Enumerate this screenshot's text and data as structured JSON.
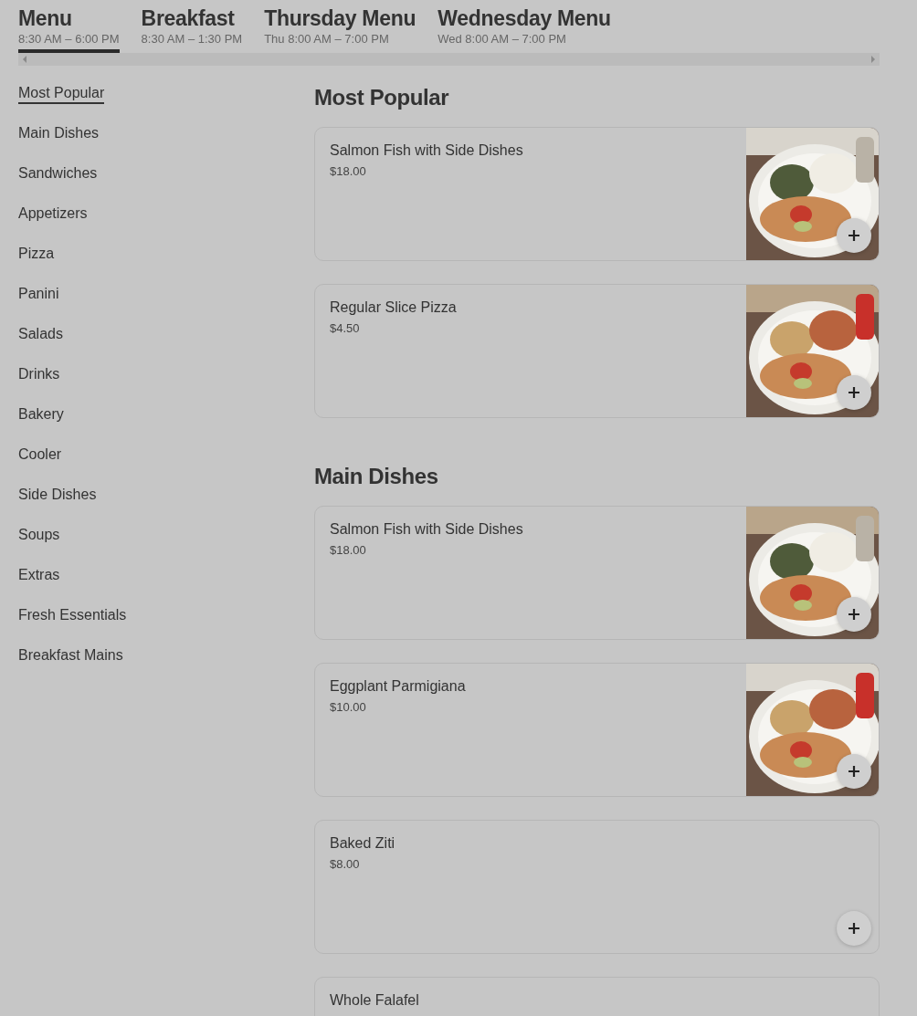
{
  "menu_tabs": [
    {
      "title": "Menu",
      "hours": "8:30 AM – 6:00 PM",
      "selected": true
    },
    {
      "title": "Breakfast",
      "hours": "8:30 AM – 1:30 PM",
      "selected": false
    },
    {
      "title": "Thursday Menu",
      "hours": "Thu 8:00 AM – 7:00 PM",
      "selected": false
    },
    {
      "title": "Wednesday Menu",
      "hours": "Wed 8:00 AM – 7:00 PM",
      "selected": false
    }
  ],
  "sidebar": {
    "items": [
      {
        "label": "Most Popular",
        "selected": true
      },
      {
        "label": "Main Dishes",
        "selected": false
      },
      {
        "label": "Sandwiches",
        "selected": false
      },
      {
        "label": "Appetizers",
        "selected": false
      },
      {
        "label": "Pizza",
        "selected": false
      },
      {
        "label": "Panini",
        "selected": false
      },
      {
        "label": "Salads",
        "selected": false
      },
      {
        "label": "Drinks",
        "selected": false
      },
      {
        "label": "Bakery",
        "selected": false
      },
      {
        "label": "Cooler",
        "selected": false
      },
      {
        "label": "Side Dishes",
        "selected": false
      },
      {
        "label": "Soups",
        "selected": false
      },
      {
        "label": "Extras",
        "selected": false
      },
      {
        "label": "Fresh Essentials",
        "selected": false
      },
      {
        "label": "Breakfast Mains",
        "selected": false
      }
    ]
  },
  "sections": [
    {
      "title": "Most Popular",
      "items": [
        {
          "name": "Salmon Fish with Side Dishes",
          "price": "$18.00"
        },
        {
          "name": "Regular Slice Pizza",
          "price": "$4.50"
        }
      ]
    },
    {
      "title": "Main Dishes",
      "items": [
        {
          "name": "Salmon Fish with Side Dishes",
          "price": "$18.00"
        },
        {
          "name": "Eggplant Parmigiana",
          "price": "$10.00"
        },
        {
          "name": "Baked Ziti",
          "price": "$8.00"
        },
        {
          "name": "Whole Falafel"
        }
      ]
    }
  ]
}
